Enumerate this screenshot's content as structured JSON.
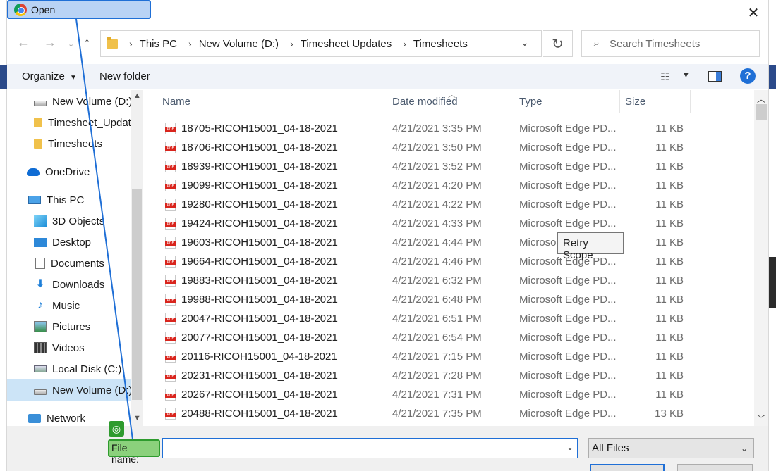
{
  "window": {
    "title": "Open",
    "close_icon": "close-icon"
  },
  "address": {
    "crumbs": [
      "This PC",
      "New Volume (D:)",
      "Timesheet Updates",
      "Timesheets"
    ]
  },
  "search": {
    "placeholder": "Search Timesheets"
  },
  "toolbar": {
    "organize_label": "Organize",
    "new_folder_label": "New folder",
    "help_label": "?"
  },
  "sidebar": {
    "items": [
      {
        "label": "New Volume (D:)",
        "icon": "drive-icon"
      },
      {
        "label": "Timesheet_Updates",
        "icon": "folder-icon"
      },
      {
        "label": "Timesheets",
        "icon": "folder-icon"
      },
      {
        "label": "OneDrive",
        "icon": "onedrive-icon"
      },
      {
        "label": "This PC",
        "icon": "pc-icon"
      },
      {
        "label": "3D Objects",
        "icon": "3d-objects-icon"
      },
      {
        "label": "Desktop",
        "icon": "desktop-icon"
      },
      {
        "label": "Documents",
        "icon": "documents-icon"
      },
      {
        "label": "Downloads",
        "icon": "downloads-icon"
      },
      {
        "label": "Music",
        "icon": "music-icon"
      },
      {
        "label": "Pictures",
        "icon": "pictures-icon"
      },
      {
        "label": "Videos",
        "icon": "videos-icon"
      },
      {
        "label": "Local Disk (C:)",
        "icon": "local-disk-icon"
      },
      {
        "label": "New Volume (D:)",
        "icon": "drive-icon"
      },
      {
        "label": "Network",
        "icon": "network-icon"
      }
    ]
  },
  "columns": [
    "Name",
    "Date modified",
    "Type",
    "Size"
  ],
  "files": [
    {
      "name": "18705-RICOH15001_04-18-2021",
      "date": "4/21/2021 3:35 PM",
      "type": "Microsoft Edge PD...",
      "size": "11 KB"
    },
    {
      "name": "18706-RICOH15001_04-18-2021",
      "date": "4/21/2021 3:50 PM",
      "type": "Microsoft Edge PD...",
      "size": "11 KB"
    },
    {
      "name": "18939-RICOH15001_04-18-2021",
      "date": "4/21/2021 3:52 PM",
      "type": "Microsoft Edge PD...",
      "size": "11 KB"
    },
    {
      "name": "19099-RICOH15001_04-18-2021",
      "date": "4/21/2021 4:20 PM",
      "type": "Microsoft Edge PD...",
      "size": "11 KB"
    },
    {
      "name": "19280-RICOH15001_04-18-2021",
      "date": "4/21/2021 4:22 PM",
      "type": "Microsoft Edge PD...",
      "size": "11 KB"
    },
    {
      "name": "19424-RICOH15001_04-18-2021",
      "date": "4/21/2021 4:33 PM",
      "type": "Microsoft Edge PD...",
      "size": "11 KB"
    },
    {
      "name": "19603-RICOH15001_04-18-2021",
      "date": "4/21/2021 4:44 PM",
      "type": "Microso",
      "size": "11 KB"
    },
    {
      "name": "19664-RICOH15001_04-18-2021",
      "date": "4/21/2021 4:46 PM",
      "type": "Microsoft Edge PD...",
      "size": "11 KB"
    },
    {
      "name": "19883-RICOH15001_04-18-2021",
      "date": "4/21/2021 6:32 PM",
      "type": "Microsoft Edge PD...",
      "size": "11 KB"
    },
    {
      "name": "19988-RICOH15001_04-18-2021",
      "date": "4/21/2021 6:48 PM",
      "type": "Microsoft Edge PD...",
      "size": "11 KB"
    },
    {
      "name": "20047-RICOH15001_04-18-2021",
      "date": "4/21/2021 6:51 PM",
      "type": "Microsoft Edge PD...",
      "size": "11 KB"
    },
    {
      "name": "20077-RICOH15001_04-18-2021",
      "date": "4/21/2021 6:54 PM",
      "type": "Microsoft Edge PD...",
      "size": "11 KB"
    },
    {
      "name": "20116-RICOH15001_04-18-2021",
      "date": "4/21/2021 7:15 PM",
      "type": "Microsoft Edge PD...",
      "size": "11 KB"
    },
    {
      "name": "20231-RICOH15001_04-18-2021",
      "date": "4/21/2021 7:28 PM",
      "type": "Microsoft Edge PD...",
      "size": "11 KB"
    },
    {
      "name": "20267-RICOH15001_04-18-2021",
      "date": "4/21/2021 7:31 PM",
      "type": "Microsoft Edge PD...",
      "size": "11 KB"
    },
    {
      "name": "20488-RICOH15001_04-18-2021",
      "date": "4/21/2021 7:35 PM",
      "type": "Microsoft Edge PD...",
      "size": "13 KB"
    }
  ],
  "tooltip": {
    "text": "Retry Scope"
  },
  "footer": {
    "file_name_label": "File name:",
    "file_name_value": "",
    "filter_value": "All Files"
  },
  "colors": {
    "accent": "#1f6fd6",
    "highlight_green": "#2e9b2e",
    "selection": "#cce4f7",
    "pdf_red": "#d9251d"
  }
}
